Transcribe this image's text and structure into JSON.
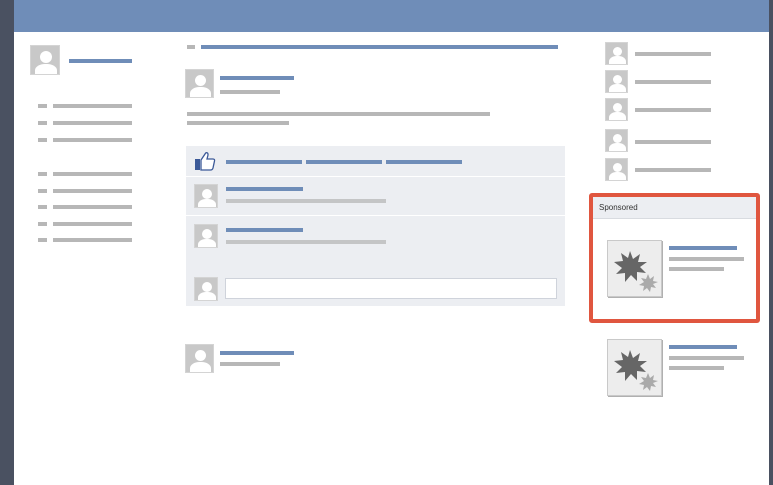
{
  "app": {
    "header_bar": "",
    "colors": {
      "accent": "#6f8db8",
      "placeholder": "#b7b7b7",
      "highlight": "#e0563f",
      "panel": "#eceef2"
    }
  },
  "ads": {
    "sponsored_label": "Sponsored"
  },
  "icons": {
    "like": "thumbs-up-icon",
    "ad_image": "starburst-icon",
    "avatar": "user-silhouette-icon"
  }
}
